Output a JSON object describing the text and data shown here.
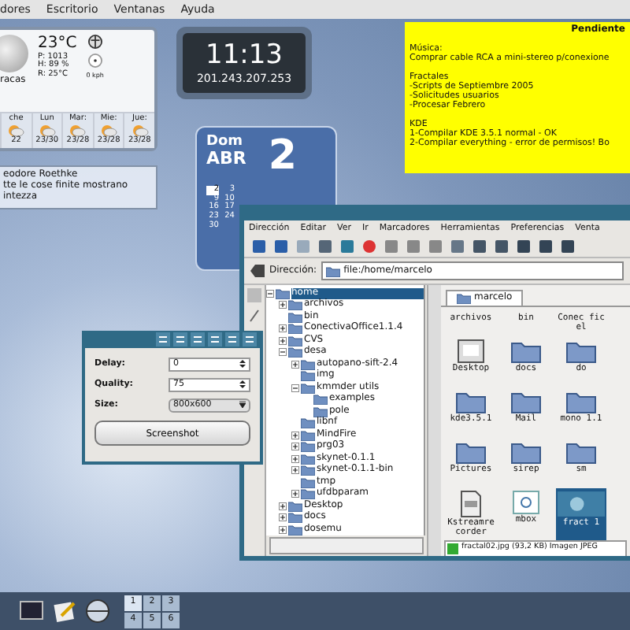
{
  "menubar": {
    "items": [
      "dores",
      "Escritorio",
      "Ventanas",
      "Ayuda"
    ]
  },
  "weather": {
    "temperature": "23°C",
    "readings": [
      "P: 1013",
      "H: 89 %",
      "R: 25°C"
    ],
    "wind": "0 kph",
    "city": "racas",
    "forecast": [
      {
        "day": "che",
        "temps": "22"
      },
      {
        "day": "Lun",
        "temps": "23/30"
      },
      {
        "day": "Mar:",
        "temps": "23/28"
      },
      {
        "day": "Mie:",
        "temps": "23/28"
      },
      {
        "day": "Jue:",
        "temps": "23/28"
      }
    ]
  },
  "quote": {
    "author": "eodore Roethke",
    "lines": [
      "tte le cose finite mostrano",
      "intezza"
    ]
  },
  "clock": {
    "time": "11:13",
    "ip": "201.243.207.253"
  },
  "calendar": {
    "weekday": "Dom",
    "month": "ABR",
    "day": "2",
    "dates": [
      {
        "label": "2",
        "selected": true
      },
      {
        "label": "3",
        "selected": false
      },
      {
        "label": "9",
        "selected": false
      },
      {
        "label": "10",
        "selected": false
      },
      {
        "label": "16",
        "selected": false
      },
      {
        "label": "17",
        "selected": false
      },
      {
        "label": "23",
        "selected": false
      },
      {
        "label": "24",
        "selected": false
      },
      {
        "label": "30",
        "selected": false
      }
    ]
  },
  "note": {
    "title": "Pendiente",
    "sections": [
      [
        "Música:",
        "Comprar cable RCA a mini-stereo p/conexione"
      ],
      [
        "Fractales",
        "-Scripts de Septiembre 2005",
        "-Solicitudes usuarios",
        "-Procesar Febrero"
      ],
      [
        "KDE",
        "1-Compilar KDE 3.5.1 normal - OK",
        "2-Compilar everything - error de permisos!  Bo"
      ]
    ]
  },
  "file_manager": {
    "menu": [
      "Dirección",
      "Editar",
      "Ver",
      "Ir",
      "Marcadores",
      "Herramientas",
      "Preferencias",
      "Venta"
    ],
    "address_label": "Dirección:",
    "address": "file:/home/marcelo",
    "tree": [
      {
        "label": "home",
        "selected": true,
        "expanded": true,
        "children": [
          {
            "label": "archivos",
            "selected": false,
            "expanded": false
          },
          {
            "label": "bin",
            "selected": false
          },
          {
            "label": "ConectivaOffice1.1.4",
            "selected": false,
            "expanded": false
          },
          {
            "label": "CVS",
            "selected": false,
            "expanded": false
          },
          {
            "label": "desa",
            "selected": false,
            "expanded": true,
            "children": [
              {
                "label": "autopano-sift-2.4",
                "selected": false,
                "expanded": false
              },
              {
                "label": "img",
                "selected": false
              },
              {
                "label": "kmmder utils",
                "selected": false,
                "expanded": true,
                "children": [
                  {
                    "label": "examples",
                    "selected": false
                  },
                  {
                    "label": "pole",
                    "selected": false
                  }
                ]
              },
              {
                "label": "libnf",
                "selected": false
              },
              {
                "label": "MindFire",
                "selected": false,
                "expanded": false
              },
              {
                "label": "prg03",
                "selected": false,
                "expanded": false
              },
              {
                "label": "skynet-0.1.1",
                "selected": false,
                "expanded": false
              },
              {
                "label": "skynet-0.1.1-bin",
                "selected": false,
                "expanded": false
              },
              {
                "label": "tmp",
                "selected": false
              },
              {
                "label": "ufdbparam",
                "selected": false,
                "expanded": false
              }
            ]
          },
          {
            "label": "Desktop",
            "selected": false,
            "expanded": false
          },
          {
            "label": "docs",
            "selected": false,
            "expanded": false
          },
          {
            "label": "dosemu",
            "selected": false,
            "expanded": false
          }
        ]
      }
    ],
    "tab": "marcelo",
    "files": [
      {
        "name": "archivos",
        "kind": "none",
        "selected": false
      },
      {
        "name": "bin",
        "kind": "none",
        "selected": false
      },
      {
        "name": "Conec ficel",
        "kind": "none",
        "selected": false
      },
      {
        "name": "Desktop",
        "kind": "desktop",
        "selected": false
      },
      {
        "name": "docs",
        "kind": "folder",
        "selected": false
      },
      {
        "name": "do",
        "kind": "folder",
        "selected": false
      },
      {
        "name": "kde3.5.1",
        "kind": "folder",
        "selected": false
      },
      {
        "name": "Mail",
        "kind": "folder",
        "selected": false
      },
      {
        "name": "mono 1.1",
        "kind": "folder",
        "selected": false
      },
      {
        "name": "Pictures",
        "kind": "folder",
        "selected": false
      },
      {
        "name": "sirep",
        "kind": "folder",
        "selected": false
      },
      {
        "name": "sm",
        "kind": "folder",
        "selected": false
      },
      {
        "name": "Kstreamrecorder",
        "kind": "file",
        "selected": false
      },
      {
        "name": "mbox",
        "kind": "mail",
        "selected": false
      },
      {
        "name": "fract 1",
        "kind": "image",
        "selected": true
      }
    ],
    "status": "fractal02.jpg (93,2 KB) Imagen JPEG"
  },
  "screenshot_dialog": {
    "fields": [
      {
        "label": "Delay:",
        "value": "0",
        "kind": "spin"
      },
      {
        "label": "Quality:",
        "value": "75",
        "kind": "spin"
      },
      {
        "label": "Size:",
        "value": "800x600",
        "kind": "combo"
      }
    ],
    "button": "Screenshot"
  },
  "taskbar": {
    "desktops": [
      {
        "label": "1",
        "selected": true
      },
      {
        "label": "2",
        "selected": false
      },
      {
        "label": "3",
        "selected": false
      },
      {
        "label": "4",
        "selected": false
      },
      {
        "label": "5",
        "selected": false
      },
      {
        "label": "6",
        "selected": false
      }
    ]
  }
}
